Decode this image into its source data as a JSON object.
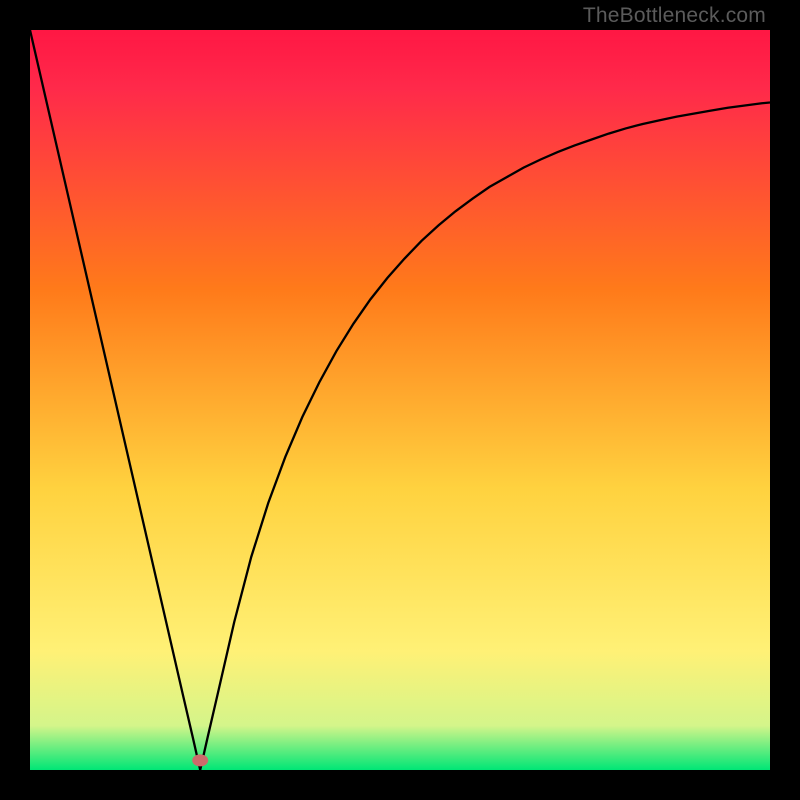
{
  "watermark": "TheBottleneck.com",
  "chart_data": {
    "type": "line",
    "title": "",
    "xlabel": "",
    "ylabel": "",
    "xlim": [
      0,
      1
    ],
    "ylim": [
      0,
      1
    ],
    "grid": false,
    "legend": false,
    "colors": {
      "gradient_top": "#ff1744",
      "gradient_mid_upper": "#ff7a1a",
      "gradient_mid": "#ffd23f",
      "gradient_mid_lower": "#fff176",
      "gradient_bottom": "#00e676",
      "line": "#000000",
      "marker": "#cc6b6b",
      "frame": "#000000"
    },
    "min_marker": {
      "x": 0.23,
      "y": 0.013,
      "label": "minimum-point"
    },
    "series": [
      {
        "name": "curve",
        "x": [
          0.0,
          0.023,
          0.046,
          0.069,
          0.092,
          0.115,
          0.138,
          0.161,
          0.184,
          0.207,
          0.22,
          0.225,
          0.228,
          0.23,
          0.232,
          0.235,
          0.24,
          0.253,
          0.276,
          0.299,
          0.322,
          0.345,
          0.368,
          0.391,
          0.414,
          0.437,
          0.46,
          0.483,
          0.506,
          0.529,
          0.552,
          0.575,
          0.598,
          0.621,
          0.644,
          0.667,
          0.69,
          0.713,
          0.736,
          0.759,
          0.782,
          0.805,
          0.828,
          0.851,
          0.874,
          0.897,
          0.92,
          0.943,
          0.966,
          0.989,
          1.0
        ],
        "values": [
          1.0,
          0.9,
          0.8,
          0.7,
          0.6,
          0.5,
          0.4,
          0.3,
          0.2,
          0.1,
          0.044,
          0.022,
          0.009,
          0.0,
          0.009,
          0.022,
          0.044,
          0.1,
          0.2,
          0.288,
          0.361,
          0.423,
          0.477,
          0.524,
          0.566,
          0.603,
          0.636,
          0.665,
          0.691,
          0.715,
          0.736,
          0.755,
          0.772,
          0.788,
          0.801,
          0.814,
          0.825,
          0.835,
          0.844,
          0.852,
          0.86,
          0.867,
          0.873,
          0.878,
          0.883,
          0.887,
          0.891,
          0.895,
          0.898,
          0.901,
          0.902
        ]
      }
    ]
  }
}
